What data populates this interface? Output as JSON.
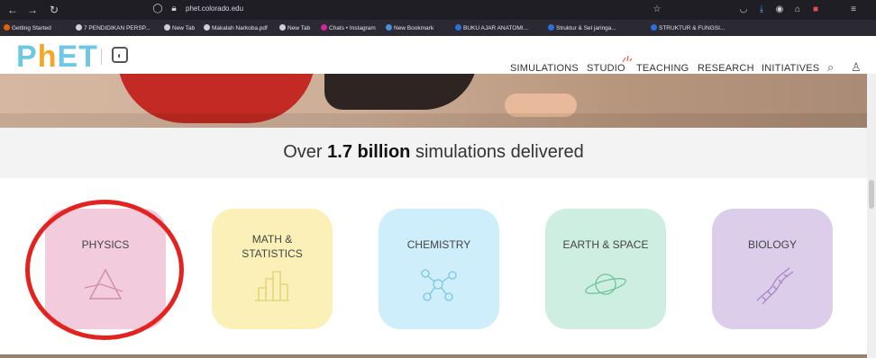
{
  "browser": {
    "url": "phet.colorado.edu",
    "bookmarks": [
      {
        "label": "Getting Started",
        "color": "#e66000"
      },
      {
        "label": "7 PENDIDIKAN PERSP...",
        "color": "#cfcfd6"
      },
      {
        "label": "New Tab",
        "color": "#cfcfd6"
      },
      {
        "label": "Makalah Narkoba.pdf",
        "color": "#cfcfd6"
      },
      {
        "label": "New Tab",
        "color": "#cfcfd6"
      },
      {
        "label": "Chats • Instagram",
        "color": "#d6249f"
      },
      {
        "label": "New Bookmark",
        "color": "#4a90e2"
      },
      {
        "label": "BUKU AJAR ANATOMI...",
        "color": "#2a6fdb"
      },
      {
        "label": "Struktur & Sel jaringa...",
        "color": "#2a6fdb"
      },
      {
        "label": "STRUKTUR & FUNGSI...",
        "color": "#2a6fdb"
      }
    ]
  },
  "header": {
    "logo_letters": [
      "P",
      "h",
      "E",
      "T"
    ],
    "nav": [
      "SIMULATIONS",
      "STUDIO",
      "TEACHING",
      "RESEARCH",
      "INITIATIVES"
    ]
  },
  "stats": {
    "prefix": "Over",
    "highlight": "1.7 billion",
    "suffix": "simulations delivered"
  },
  "subjects": [
    {
      "label": "PHYSICS",
      "icon": "prism-icon",
      "color": "#f2cbdc",
      "highlighted": true
    },
    {
      "label": "MATH & STATISTICS",
      "icon": "bar-chart-icon",
      "color": "#fbf1b8"
    },
    {
      "label": "CHEMISTRY",
      "icon": "molecule-icon",
      "color": "#cdeefa"
    },
    {
      "label": "EARTH & SPACE",
      "icon": "planet-icon",
      "color": "#cdeee0"
    },
    {
      "label": "BIOLOGY",
      "icon": "dna-icon",
      "color": "#dccdea"
    }
  ],
  "colors": {
    "highlight_ring": "#e3231f",
    "logo_blue": "#6fc7e6",
    "logo_orange": "#f5a623"
  }
}
